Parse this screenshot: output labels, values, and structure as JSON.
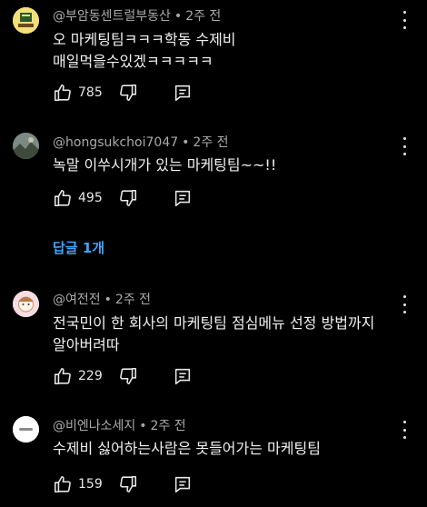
{
  "comments": [
    {
      "author": "@부암동센트럴부동산",
      "time": "2주 전",
      "text": "오 마케팅팀ㅋㅋㅋ학동 수제비 매일먹을수있겠ㅋㅋㅋㅋㅋ",
      "likes": "785"
    },
    {
      "author": "@hongsukchoi7047",
      "time": "2주 전",
      "text": "녹말 이쑤시개가 있는 마케팅팀~~!!",
      "likes": "495"
    },
    {
      "author": "@여전전",
      "time": "2주 전",
      "text": "전국민이 한 회사의 마케팅팀 점심메뉴 선정 방법까지 알아버려따",
      "likes": "229"
    },
    {
      "author": "@비엔나소세지",
      "time": "2주 전",
      "text": "수제비 싫어하는사람은 못들어가는 마케팅팀",
      "likes": "159"
    }
  ],
  "replies_label": "답글 1개",
  "colors": {
    "background": "#000000",
    "meta": "#aaaaaa",
    "link": "#3ea6ff"
  },
  "icons": [
    "thumb-up-icon",
    "thumb-down-icon",
    "reply-icon",
    "more-vertical-icon"
  ]
}
